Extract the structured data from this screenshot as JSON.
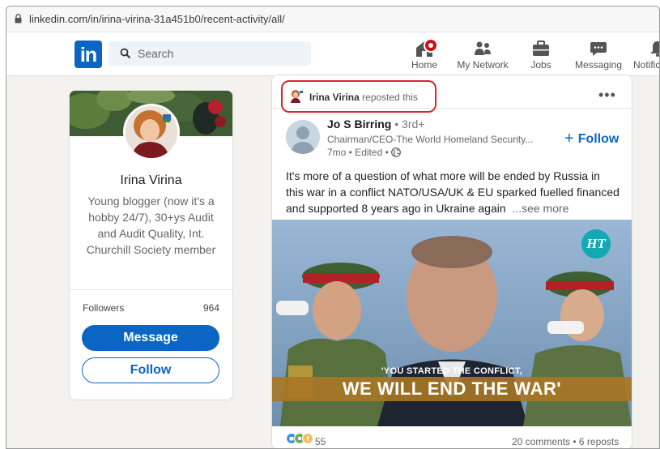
{
  "browser": {
    "url": "linkedin.com/in/irina-virina-31a451b0/recent-activity/all/"
  },
  "nav": {
    "logo": "in",
    "search_placeholder": "Search",
    "items": [
      {
        "label": "Home",
        "icon": "home-icon"
      },
      {
        "label": "My Network",
        "icon": "network-icon"
      },
      {
        "label": "Jobs",
        "icon": "briefcase-icon"
      },
      {
        "label": "Messaging",
        "icon": "messaging-icon"
      },
      {
        "label": "Notific",
        "icon": "bell-icon"
      }
    ]
  },
  "profile": {
    "name": "Irina Virina",
    "headline": "Young blogger (now it's a hobby 24/7), 30+ys Audit and Audit Quality, Int. Churchill Society member",
    "followers_label": "Followers",
    "followers_count": "964",
    "message_button": "Message",
    "follow_button": "Follow"
  },
  "post": {
    "reposter_name": "Irina Virina",
    "repost_action": "reposted this",
    "author_name": "Jo S Birring",
    "author_degree": "• 3rd+",
    "author_title": "Chairman/CEO-The World Homeland Security...",
    "author_time": "7mo • Edited •",
    "follow_label": "Follow",
    "text": "It's more of a question of what more will be ended by Russia in this war in a conflict NATO/USA/UK & EU sparked fuelled financed and supported 8 years ago in Ukraine again",
    "see_more": "...see more",
    "image_caption_top": "'YOU STARTED THE CONFLICT,",
    "image_caption_main": "WE WILL END THE WAR'",
    "image_logo": "HT",
    "reaction_count": "55",
    "comments_reposts": "20 comments • 6 reposts"
  },
  "colors": {
    "brand": "#0a66c2",
    "highlight": "#d9252b",
    "notification": "#cc1016"
  }
}
